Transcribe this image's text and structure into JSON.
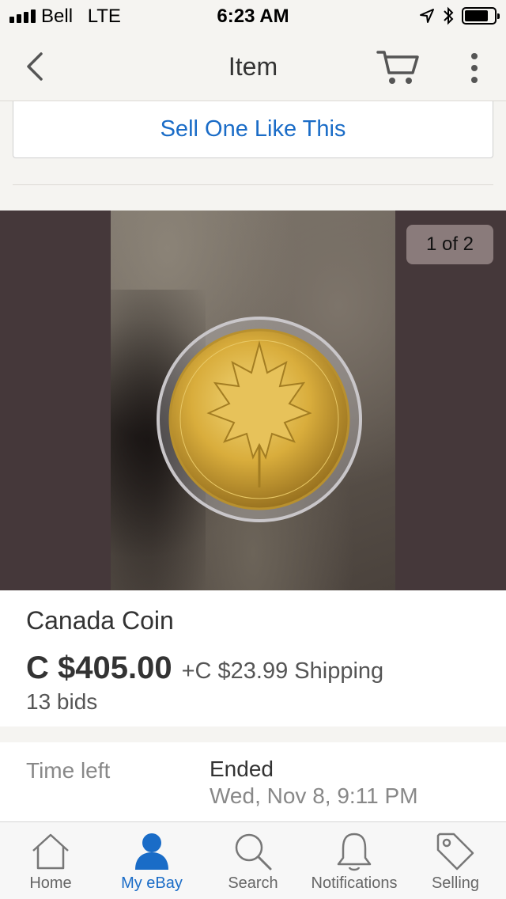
{
  "status_bar": {
    "carrier": "Bell",
    "network": "LTE",
    "time": "6:23 AM",
    "icons": [
      "signal-icon",
      "location-arrow-icon",
      "bluetooth-icon",
      "battery-icon"
    ]
  },
  "nav": {
    "title": "Item",
    "back_icon": "chevron-left-icon",
    "cart_icon": "cart-icon",
    "more_icon": "more-vertical-icon"
  },
  "sell_button": {
    "label": "Sell One Like This"
  },
  "gallery": {
    "counter": "1 of 2",
    "image_subject": "coin-photo"
  },
  "item": {
    "title": "Canada Coin",
    "price": "C $405.00",
    "shipping": "+C $23.99 Shipping",
    "bids": "13 bids"
  },
  "time_left": {
    "label": "Time left",
    "status": "Ended",
    "date": "Wed, Nov 8, 9:11 PM"
  },
  "tabs": [
    {
      "label": "Home",
      "icon": "home-icon",
      "active": false
    },
    {
      "label": "My eBay",
      "icon": "person-icon",
      "active": true
    },
    {
      "label": "Search",
      "icon": "search-icon",
      "active": false
    },
    {
      "label": "Notifications",
      "icon": "bell-icon",
      "active": false
    },
    {
      "label": "Selling",
      "icon": "tag-icon",
      "active": false
    }
  ],
  "colors": {
    "accent": "#1a6cc7",
    "background": "#f5f4f1",
    "gallery_background": "#45383a"
  }
}
